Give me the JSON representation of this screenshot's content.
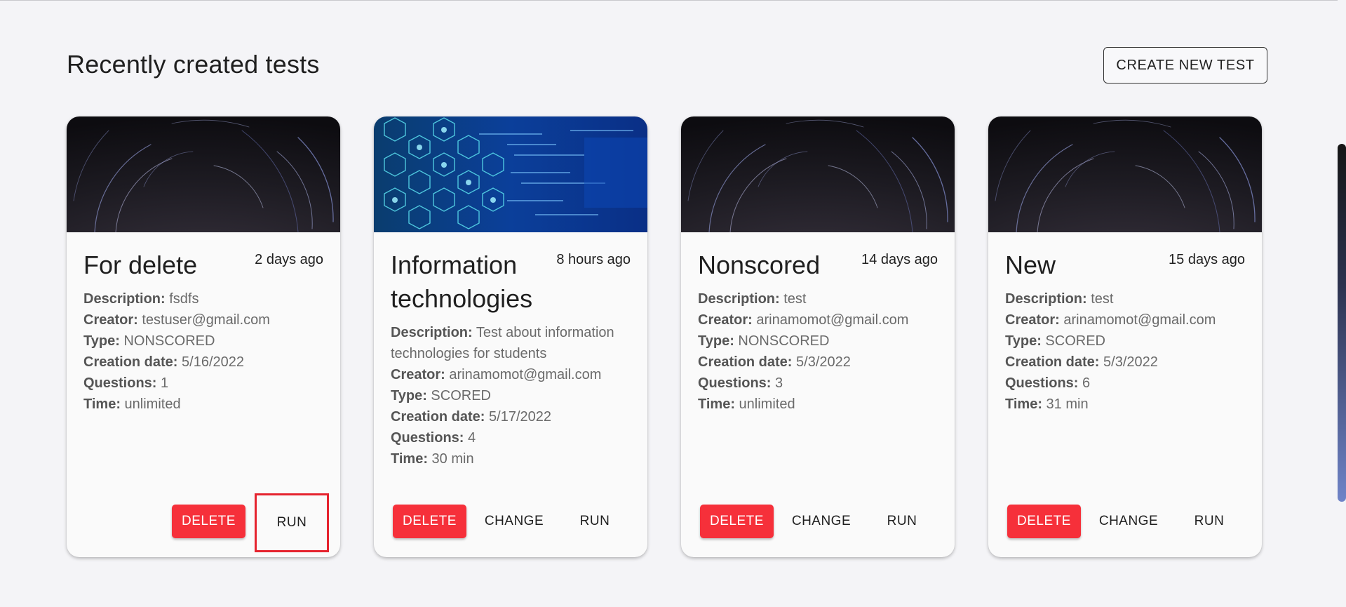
{
  "header": {
    "title": "Recently created tests",
    "create_button": "CREATE NEW TEST"
  },
  "labels": {
    "description": "Description:",
    "creator": "Creator:",
    "type": "Type:",
    "creation_date": "Creation date:",
    "questions": "Questions:",
    "time": "Time:",
    "delete": "DELETE",
    "change": "CHANGE",
    "run": "RUN"
  },
  "cards": [
    {
      "image": "star-trails",
      "title": "For delete",
      "ago": "2 days ago",
      "description": "fsdfs",
      "creator": "testuser@gmail.com",
      "type": "NONSCORED",
      "creation_date": "5/16/2022",
      "questions": "1",
      "time": "unlimited"
    },
    {
      "image": "information-technology",
      "title": "Information technologies",
      "ago": "8 hours ago",
      "description": "Test about information technologies for students",
      "creator": "arinamomot@gmail.com",
      "type": "SCORED",
      "creation_date": "5/17/2022",
      "questions": "4",
      "time": "30 min"
    },
    {
      "image": "star-trails",
      "title": "Nonscored",
      "ago": "14 days ago",
      "description": "test",
      "creator": "arinamomot@gmail.com",
      "type": "NONSCORED",
      "creation_date": "5/3/2022",
      "questions": "3",
      "time": "unlimited"
    },
    {
      "image": "star-trails",
      "title": "New",
      "ago": "15 days ago",
      "description": "test",
      "creator": "arinamomot@gmail.com",
      "type": "SCORED",
      "creation_date": "5/3/2022",
      "questions": "6",
      "time": "31 min"
    }
  ],
  "colors": {
    "delete_button": "#f6303a",
    "highlight_box": "#e5232e",
    "background": "#f4f4f7"
  }
}
